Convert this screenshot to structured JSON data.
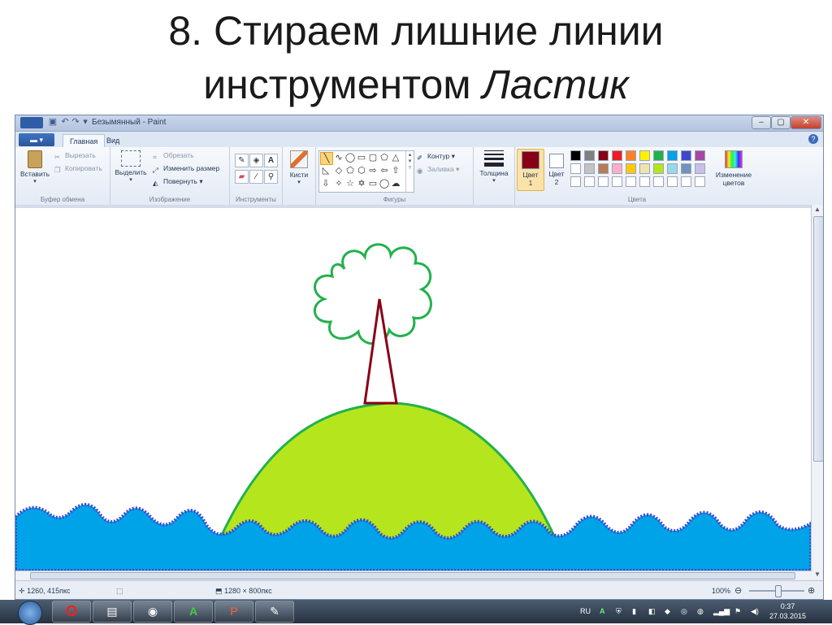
{
  "slide": {
    "title_line1": "8. Стираем лишние линии",
    "title_line2_normal": "инструментом",
    "title_line2_italic": "Ластик"
  },
  "window": {
    "title": "Безымянный - Paint",
    "minimize": "–",
    "maximize": "▢",
    "close": "✕"
  },
  "tabs": {
    "file": "▬ ▾",
    "home": "Главная",
    "view": "Вид",
    "help": "?"
  },
  "ribbon": {
    "clipboard": {
      "paste": "Вставить",
      "cut": "Вырезать",
      "copy": "Копировать",
      "label": "Буфер обмена"
    },
    "image": {
      "select": "Выделить",
      "crop": "Обрезать",
      "resize": "Изменить размер",
      "rotate": "Повернуть",
      "label": "Изображение"
    },
    "tools": {
      "label": "Инструменты",
      "text_tool": "A"
    },
    "brushes": {
      "label": "Кисти"
    },
    "shapes": {
      "outline": "Контур",
      "fill": "Заливка",
      "label": "Фигуры"
    },
    "size": {
      "label": "Толщина"
    },
    "colors": {
      "color1": "Цвет 1",
      "color2": "Цвет 2",
      "edit": "Изменение цветов",
      "label": "Цвета"
    }
  },
  "palette": [
    "#000000",
    "#7f7f7f",
    "#880015",
    "#ed1c24",
    "#ff7f27",
    "#fff200",
    "#22b14c",
    "#00a2e8",
    "#3f48cc",
    "#a349a4",
    "#ffffff",
    "#c3c3c3",
    "#b97a57",
    "#ffaec9",
    "#ffc90e",
    "#efe4b0",
    "#b5e61d",
    "#99d9ea",
    "#7092be",
    "#c8bfe7"
  ],
  "selected_colors": {
    "color1": "#880015",
    "color2": "#ffffff"
  },
  "status": {
    "cursor": "1260, 415пкс",
    "canvas_size": "1280 × 800пкс",
    "zoom": "100%"
  },
  "taskbar": {
    "lang": "RU",
    "time": "0:37",
    "date": "27.03.2015"
  },
  "drawing_colors": {
    "sea": "#00a2e8",
    "sea_edge": "#3f48cc",
    "hill": "#b5e61d",
    "outline": "#22b14c",
    "trunk": "#880015"
  }
}
